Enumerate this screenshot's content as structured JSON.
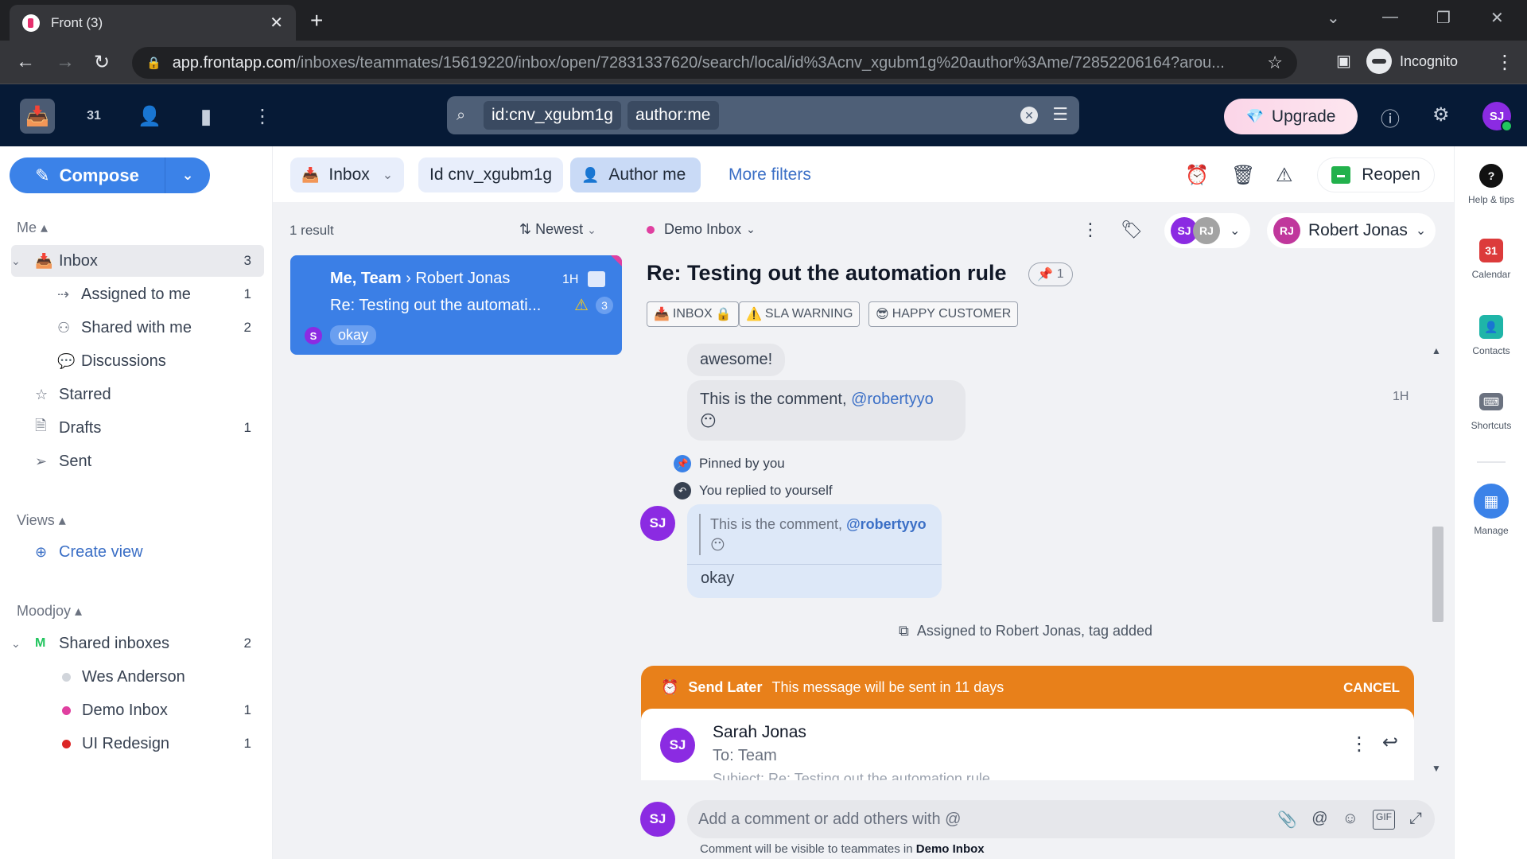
{
  "browser": {
    "tab_title": "Front (3)",
    "url_host": "app.frontapp.com",
    "url_path": "/inboxes/teammates/15619220/inbox/open/72831337620/search/local/id%3Acnv_xgubm1g%20author%3Ame/72852206164?arou...",
    "profile_label": "Incognito"
  },
  "header": {
    "search_chips": [
      "id:cnv_xgubm1g",
      "author:me"
    ],
    "upgrade_label": "Upgrade",
    "user_initials": "SJ"
  },
  "sidebar": {
    "compose_label": "Compose",
    "me_section": "Me",
    "items": [
      {
        "label": "Inbox",
        "count": "3"
      },
      {
        "label": "Assigned to me",
        "count": "1"
      },
      {
        "label": "Shared with me",
        "count": "2"
      },
      {
        "label": "Discussions",
        "count": ""
      },
      {
        "label": "Starred",
        "count": ""
      },
      {
        "label": "Drafts",
        "count": "1"
      },
      {
        "label": "Sent",
        "count": ""
      }
    ],
    "views_section": "Views",
    "create_view_label": "Create view",
    "team_section": "Moodjoy",
    "shared_inboxes": {
      "label": "Shared inboxes",
      "count": "2",
      "badge": "M"
    },
    "team_inboxes": [
      {
        "label": "Wes Anderson",
        "count": "",
        "color": "#d1d5db"
      },
      {
        "label": "Demo Inbox",
        "count": "1",
        "color": "#e040a0"
      },
      {
        "label": "UI Redesign",
        "count": "1",
        "color": "#dc2626"
      }
    ]
  },
  "filters": {
    "inbox_label": "Inbox",
    "id_label": "Id cnv_xgubm1g",
    "author_label": "Author me",
    "more_filters_label": "More filters",
    "reopen_label": "Reopen"
  },
  "list": {
    "result_count": "1 result",
    "sort_label": "Newest",
    "conversation": {
      "participants": "Me, Team",
      "recipient": "Robert Jonas",
      "time": "1H",
      "subject": "Re: Testing out the automati...",
      "count": "3",
      "sender_initial": "S",
      "preview": "okay"
    }
  },
  "conversation": {
    "inbox_label": "Demo Inbox",
    "inbox_color": "#e040a0",
    "subject": "Re: Testing out the automation rule",
    "pin_count": "1",
    "tags": [
      "INBOX",
      "SLA WARNING",
      "HAPPY CUSTOMER"
    ],
    "assignee_initials": [
      "SJ",
      "RJ"
    ],
    "owner_initials": "RJ",
    "owner_name": "Robert Jonas",
    "messages": [
      {
        "text": "awesome!"
      },
      {
        "text": "This is the comment, ",
        "mention": "@robertyyo",
        "emoji": "😶",
        "time": "1H"
      }
    ],
    "events": {
      "pinned": "Pinned by you",
      "replied": "You replied to yourself",
      "assigned": "Assigned to Robert Jonas, tag added"
    },
    "reply": {
      "author_initials": "SJ",
      "quote_text": "This is the comment, ",
      "quote_mention": "@robertyyo",
      "quote_emoji": "😶",
      "text": "okay"
    },
    "send_later": {
      "label": "Send Later",
      "message": "This message will be sent in 11 days",
      "cancel_label": "CANCEL"
    },
    "draft": {
      "author_initials": "SJ",
      "author_name": "Sarah Jonas",
      "to": "To: Team",
      "subject": "Subject: Re: Testing out the automation rule"
    },
    "comment_placeholder": "Add a comment or add others with @",
    "comment_note_prefix": "Comment will be visible to teammates in ",
    "comment_note_inbox": "Demo Inbox",
    "commenter_initials": "SJ"
  },
  "rail": {
    "items": [
      {
        "label": "Help & tips"
      },
      {
        "label": "Calendar",
        "glyph": "31"
      },
      {
        "label": "Contacts"
      },
      {
        "label": "Shortcuts"
      },
      {
        "label": "Manage"
      }
    ]
  },
  "colors": {
    "accent": "#3b82e8",
    "send_later": "#e8801a",
    "header_bg": "#061a36",
    "avatar_sj": "#8b2be2",
    "avatar_rj_owner": "#c0379c",
    "avatar_rj_gray": "#a3a3a3"
  }
}
